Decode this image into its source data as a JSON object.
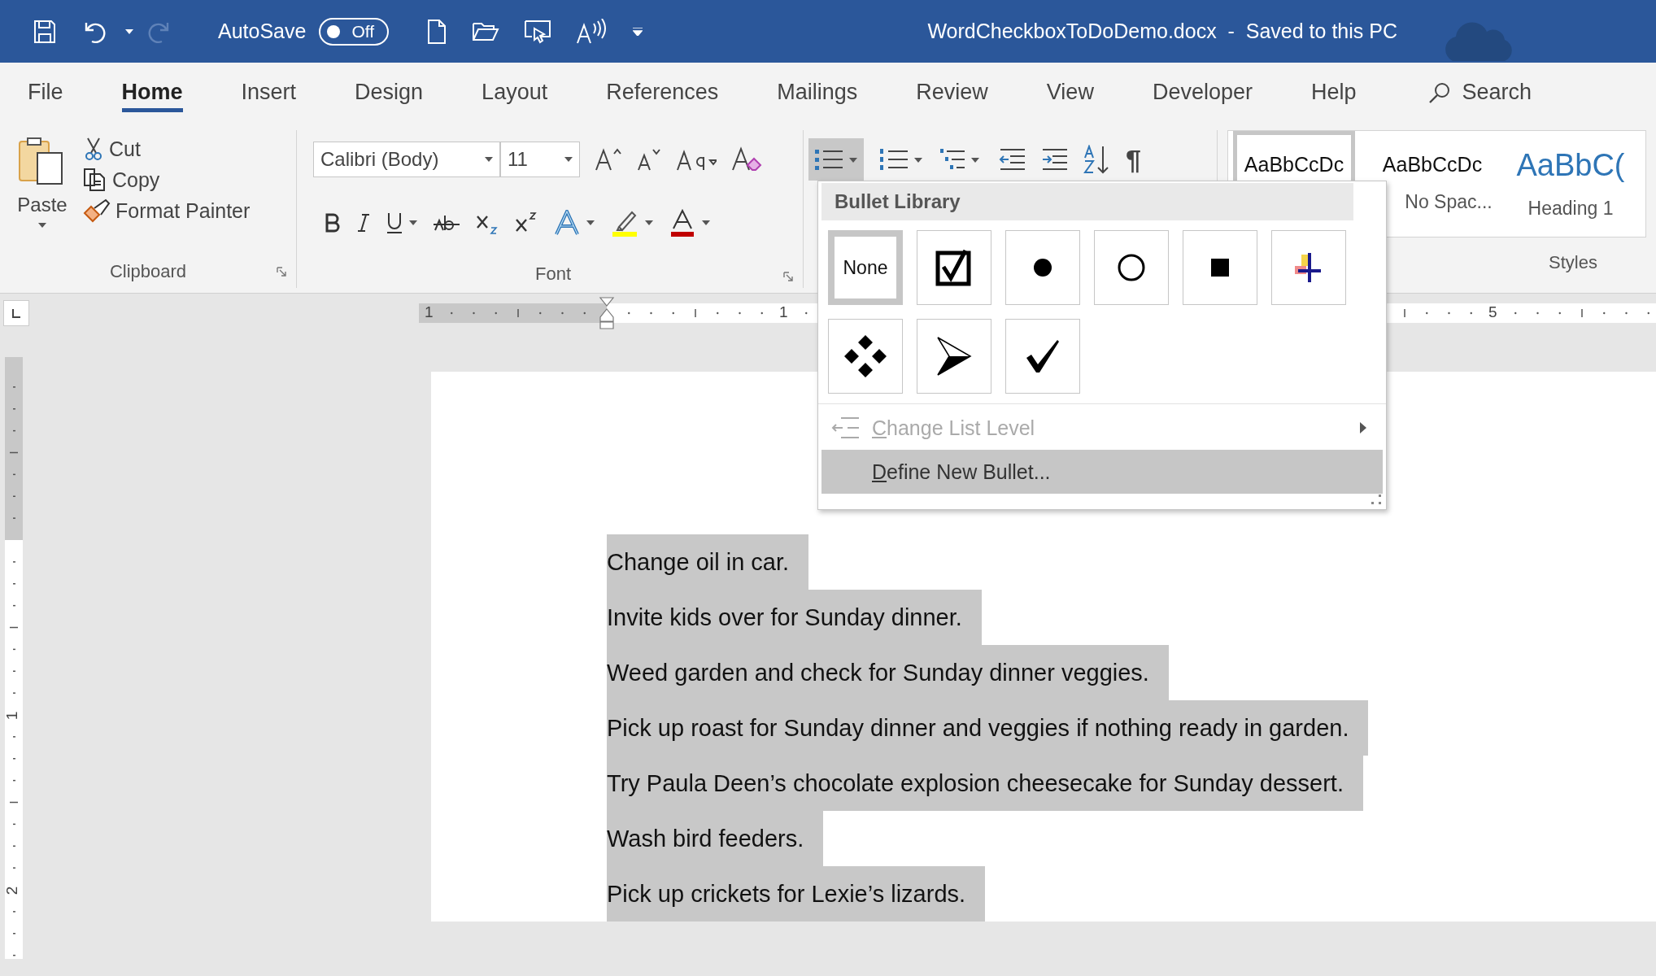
{
  "title_bar": {
    "title": "WordCheckboxToDoDemo.docx  -  Saved to this PC",
    "autosave": {
      "label": "AutoSave",
      "toggle_text": "Off",
      "on": false
    },
    "redo_disabled": true
  },
  "tabs": [
    {
      "label": "File",
      "selected": false
    },
    {
      "label": "Home",
      "selected": true
    },
    {
      "label": "Insert",
      "selected": false
    },
    {
      "label": "Design",
      "selected": false
    },
    {
      "label": "Layout",
      "selected": false
    },
    {
      "label": "References",
      "selected": false
    },
    {
      "label": "Mailings",
      "selected": false
    },
    {
      "label": "Review",
      "selected": false
    },
    {
      "label": "View",
      "selected": false
    },
    {
      "label": "Developer",
      "selected": false
    },
    {
      "label": "Help",
      "selected": false
    }
  ],
  "search": {
    "label": "Search"
  },
  "clipboard": {
    "paste": "Paste",
    "cut": "Cut",
    "copy": "Copy",
    "format_painter": "Format Painter",
    "group_label": "Clipboard"
  },
  "font": {
    "font_name": "Calibri (Body)",
    "font_size": "11",
    "group_label": "Font"
  },
  "paragraph": {
    "bullets_pressed": true,
    "show_marks_symbol": "¶"
  },
  "styles": {
    "items": [
      {
        "sample": "AaBbCcDc",
        "kind": "normal",
        "selected": true
      },
      {
        "sample": "AaBbCcDc",
        "label": "No Spac...",
        "kind": "normal",
        "selected": false
      },
      {
        "sample": "AaBbC(",
        "label": "Heading 1",
        "kind": "heading",
        "selected": false
      }
    ],
    "group_label": "Styles"
  },
  "ruler": {
    "horizontal_labels": [
      {
        "label": "1"
      },
      {
        "label": "1"
      },
      {
        "label": "5"
      }
    ],
    "vertical_labels": [
      {
        "label": "1"
      },
      {
        "label": "2"
      }
    ]
  },
  "bullet_library": {
    "title": "Bullet Library",
    "items": [
      {
        "kind": "none",
        "label": "None",
        "selected": true
      },
      {
        "kind": "checkbox",
        "selected": false
      },
      {
        "kind": "filled-circle",
        "selected": false
      },
      {
        "kind": "hollow-circle",
        "selected": false
      },
      {
        "kind": "square",
        "selected": false
      },
      {
        "kind": "picture-symbol",
        "selected": false
      },
      {
        "kind": "diamonds",
        "selected": false
      },
      {
        "kind": "arrowhead",
        "selected": false
      },
      {
        "kind": "checkmark",
        "selected": false
      }
    ],
    "menu": [
      {
        "label": "Change List Level",
        "disabled": true,
        "highlighted": false,
        "submenu": true
      },
      {
        "label": "Define New Bullet...",
        "disabled": false,
        "highlighted": true,
        "submenu": false
      }
    ]
  },
  "document": {
    "lines": [
      {
        "text": "Change oil in car.",
        "selected": true
      },
      {
        "text": "Invite kids over for Sunday dinner.",
        "selected": true
      },
      {
        "text": "Weed garden and check for Sunday dinner veggies.",
        "selected": true
      },
      {
        "text": "Pick up roast for Sunday dinner and veggies if nothing ready in garden.",
        "selected": true
      },
      {
        "text": "Try Paula Deen’s chocolate explosion cheesecake for Sunday dessert.",
        "selected": true
      },
      {
        "text": "Wash bird feeders.",
        "selected": true
      },
      {
        "text": "Pick up crickets for Lexie’s lizards.",
        "selected": true
      }
    ]
  }
}
